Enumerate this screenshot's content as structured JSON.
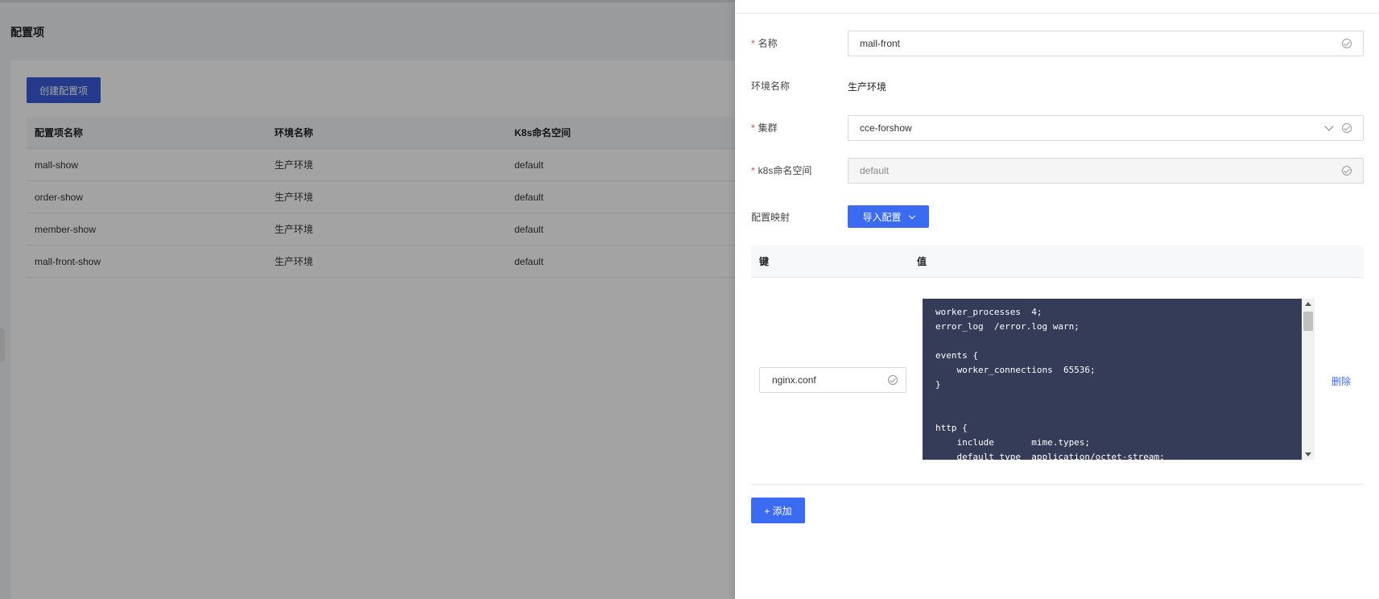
{
  "background": {
    "page_title": "配置项",
    "create_button": "创建配置项",
    "table": {
      "headers": [
        "配置项名称",
        "环境名称",
        "K8s命名空间"
      ],
      "rows": [
        [
          "mall-show",
          "生产环境",
          "default"
        ],
        [
          "order-show",
          "生产环境",
          "default"
        ],
        [
          "member-show",
          "生产环境",
          "default"
        ],
        [
          "mall-front-show",
          "生产环境",
          "default"
        ]
      ]
    }
  },
  "drawer": {
    "name": {
      "label": "名称",
      "value": "mall-front"
    },
    "env": {
      "label": "环境名称",
      "value": "生产环境"
    },
    "cluster": {
      "label": "集群",
      "value": "cce-forshow"
    },
    "namespace": {
      "label": "k8s命名空间",
      "placeholder": "default"
    },
    "config_map": {
      "label": "配置映射",
      "import_button": "导入配置"
    },
    "map_table": {
      "key_header": "键",
      "value_header": "值",
      "key_value": "nginx.conf",
      "code": "worker_processes  4;\nerror_log  /error.log warn;\n\nevents {\n    worker_connections  65536;\n}\n\n\nhttp {\n    include       mime.types;\n    default_type  application/octet-stream;",
      "delete_label": "删除"
    },
    "add_button": "+ 添加"
  },
  "colors": {
    "primary": "#3a6bf0",
    "required": "#e5483c",
    "code_bg": "#353c57"
  }
}
